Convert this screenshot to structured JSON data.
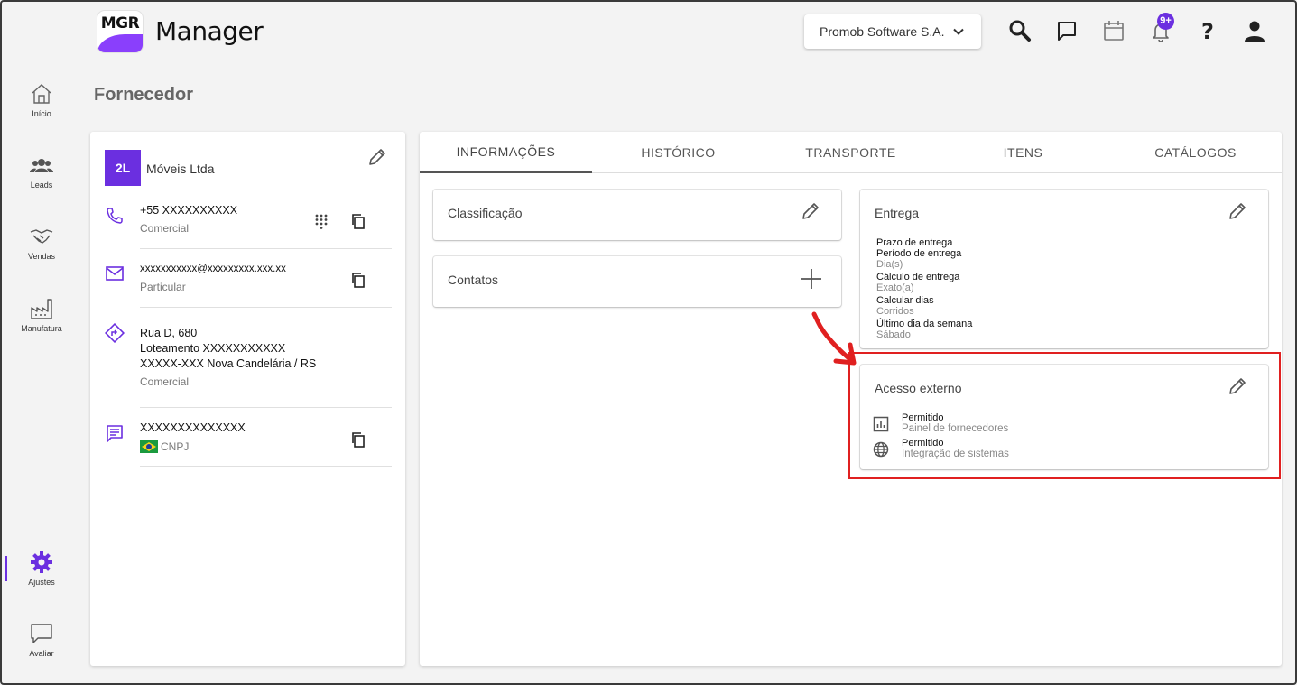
{
  "header": {
    "logo_text": "MGR",
    "app_title": "Manager",
    "company_selector": "Promob Software S.A.",
    "notification_badge": "9+"
  },
  "sidebar": {
    "items": [
      {
        "label": "Início",
        "icon": "home-icon"
      },
      {
        "label": "Leads",
        "icon": "people-icon"
      },
      {
        "label": "Vendas",
        "icon": "handshake-icon"
      },
      {
        "label": "Manufatura",
        "icon": "factory-icon"
      },
      {
        "label": "Ajustes",
        "icon": "gear-icon",
        "active": true
      },
      {
        "label": "Avaliar",
        "icon": "chat-bubble-icon"
      }
    ]
  },
  "page": {
    "title": "Fornecedor"
  },
  "supplier": {
    "initials": "2L",
    "name": "Móveis Ltda",
    "phone": {
      "value": "+55 XXXXXXXXXX",
      "type": "Comercial"
    },
    "email": {
      "value": "xxxxxxxxxxx@xxxxxxxxx.xxx.xx",
      "type": "Particular"
    },
    "address": {
      "line1": "Rua D, 680",
      "line2": "Loteamento  XXXXXXXXXXX",
      "line3": "XXXXX-XXX Nova Candelária / RS",
      "type": "Comercial"
    },
    "document": {
      "value": "XXXXXXXXXXXXXX",
      "type": "CNPJ"
    }
  },
  "tabs": [
    "INFORMAÇÕES",
    "HISTÓRICO",
    "TRANSPORTE",
    "ITENS",
    "CATÁLOGOS"
  ],
  "sections": {
    "classificacao": {
      "title": "Classificação"
    },
    "contatos": {
      "title": "Contatos"
    },
    "entrega": {
      "title": "Entrega",
      "fields": [
        {
          "label": "Prazo de entrega",
          "value": ""
        },
        {
          "label": "Período de entrega",
          "value": "Dia(s)"
        },
        {
          "label": "Cálculo de entrega",
          "value": "Exato(a)"
        },
        {
          "label": "Calcular dias",
          "value": "Corridos"
        },
        {
          "label": "Último dia da semana",
          "value": "Sábado"
        }
      ]
    },
    "acesso_externo": {
      "title": "Acesso externo",
      "items": [
        {
          "status": "Permitido",
          "description": "Painel de fornecedores",
          "icon": "chart-icon"
        },
        {
          "status": "Permitido",
          "description": "Integração de sistemas",
          "icon": "globe-icon"
        }
      ]
    }
  },
  "colors": {
    "accent": "#6b2fe0",
    "highlight": "#e02020"
  }
}
